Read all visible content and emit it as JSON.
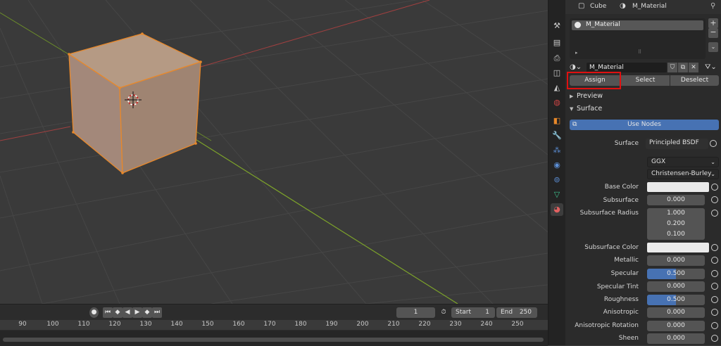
{
  "header": {
    "object_name": "Cube",
    "material_name": "M_Material"
  },
  "material_slots": [
    {
      "name": "M_Material"
    }
  ],
  "datablock": {
    "name": "M_Material"
  },
  "assign_buttons": {
    "assign": "Assign",
    "select": "Select",
    "deselect": "Deselect"
  },
  "sections": {
    "preview": "Preview",
    "surface": "Surface"
  },
  "use_nodes_label": "Use Nodes",
  "surface": {
    "label": "Surface",
    "shader": "Principled BSDF",
    "distribution": "GGX",
    "subsurface_method": "Christensen-Burley"
  },
  "properties": [
    {
      "label": "Base Color",
      "kind": "color"
    },
    {
      "label": "Subsurface",
      "value": "0.000",
      "fraction": 0
    },
    {
      "label": "Subsurface Radius",
      "values": [
        "1.000",
        "0.200",
        "0.100"
      ]
    },
    {
      "label": "Subsurface Color",
      "kind": "color"
    },
    {
      "label": "Metallic",
      "value": "0.000",
      "fraction": 0
    },
    {
      "label": "Specular",
      "value": "0.500",
      "fraction": 0.5
    },
    {
      "label": "Specular Tint",
      "value": "0.000",
      "fraction": 0
    },
    {
      "label": "Roughness",
      "value": "0.500",
      "fraction": 0.5
    },
    {
      "label": "Anisotropic",
      "value": "0.000",
      "fraction": 0
    },
    {
      "label": "Anisotropic Rotation",
      "value": "0.000",
      "fraction": 0
    },
    {
      "label": "Sheen",
      "value": "0.000",
      "fraction": 0
    }
  ],
  "timeline": {
    "current_frame": "1",
    "start_label": "Start",
    "start": "1",
    "end_label": "End",
    "end": "250",
    "ruler": [
      "90",
      "100",
      "110",
      "120",
      "130",
      "140",
      "150",
      "160",
      "170",
      "180",
      "190",
      "200",
      "210",
      "220",
      "230",
      "240",
      "250"
    ]
  },
  "colors": {
    "accent": "#4772b3",
    "highlight_box": "#e01010",
    "cube_fill": "#a88a74",
    "cube_edge": "#e8882a"
  }
}
